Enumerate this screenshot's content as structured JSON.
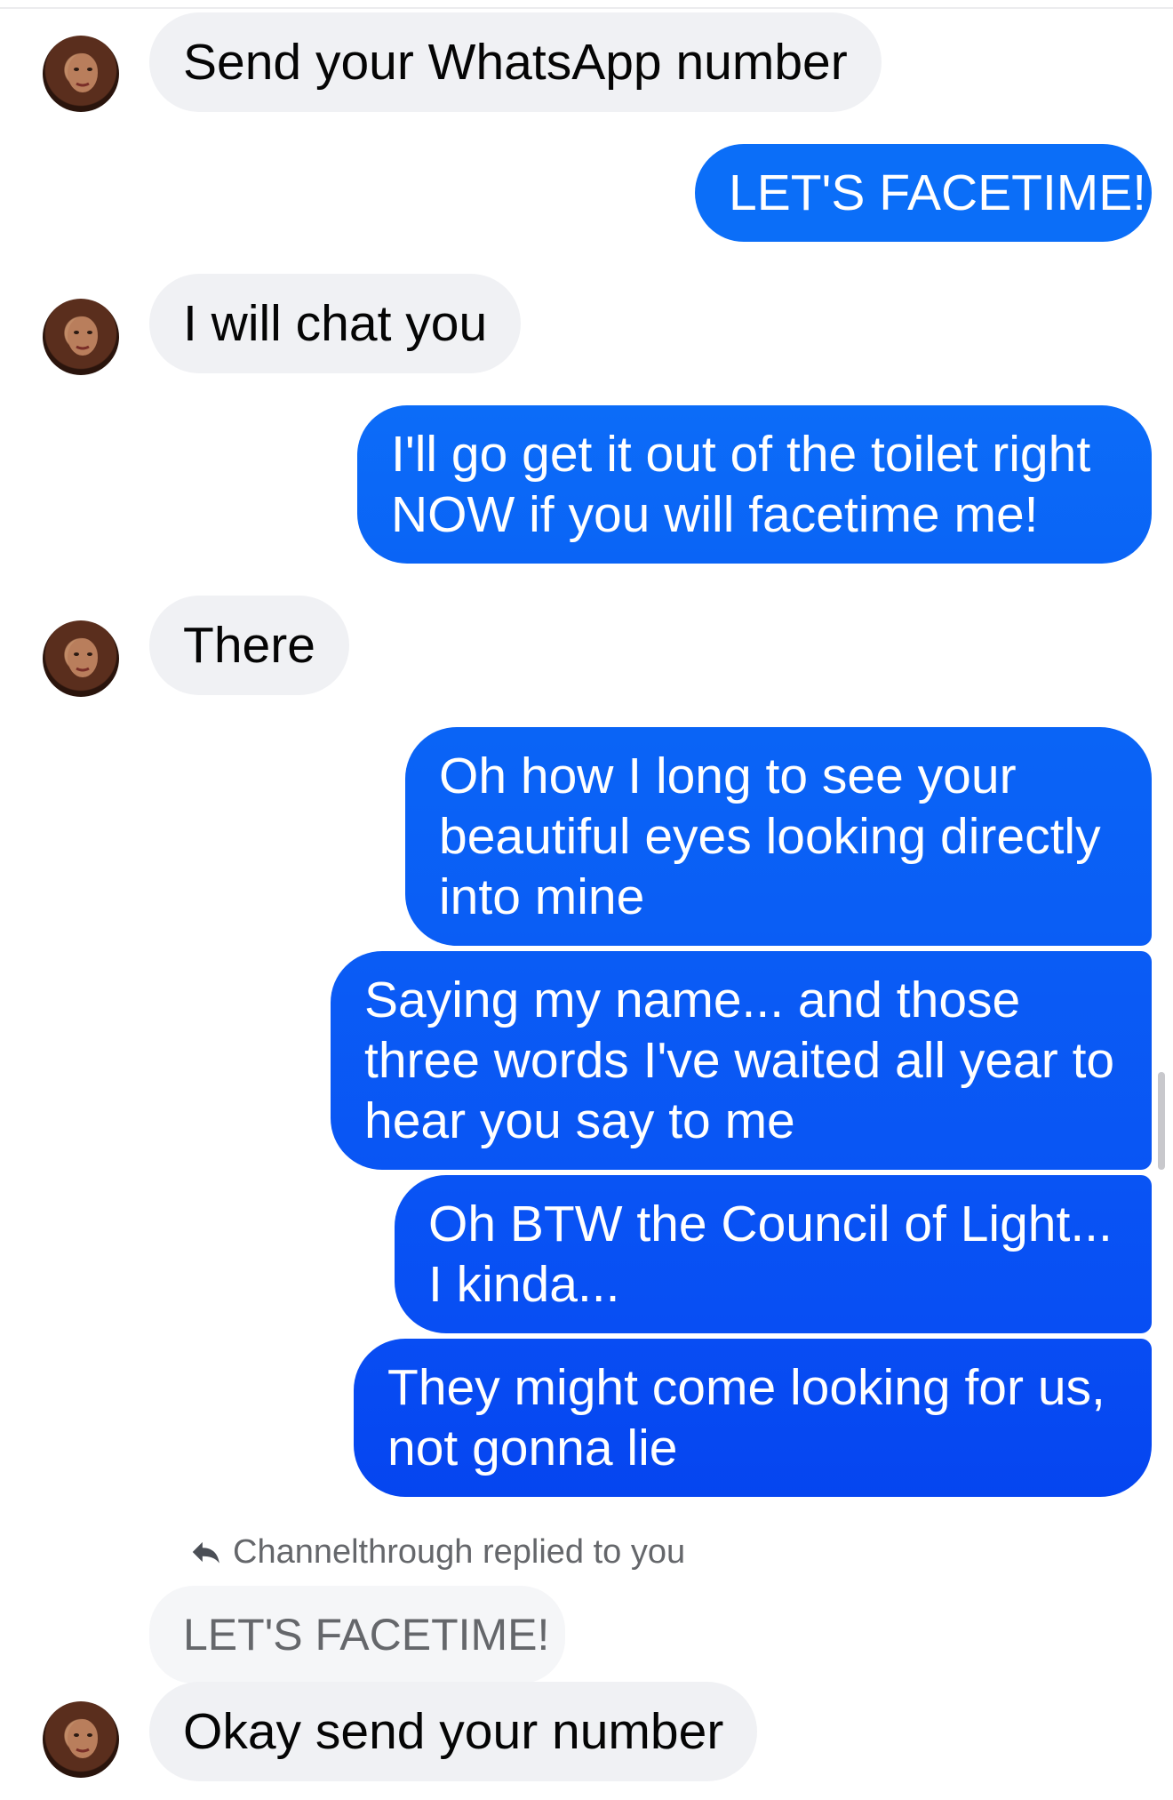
{
  "colors": {
    "incoming_bg": "#f0f1f4",
    "outgoing_top": "#0b6ef8",
    "outgoing_bottom": "#0545f0",
    "meta_text": "#65676b"
  },
  "icons": {
    "avatar": "contact-avatar",
    "reply": "reply-arrow-icon"
  },
  "messages": [
    {
      "dir": "in",
      "text": "Send your WhatsApp number"
    },
    {
      "dir": "out",
      "text": "LET'S FACETIME!"
    },
    {
      "dir": "in",
      "text": "I will chat you"
    },
    {
      "dir": "out",
      "text": "I'll go get it out of the toilet right NOW if you will facetime me!"
    },
    {
      "dir": "in",
      "text": "There"
    },
    {
      "dir": "out",
      "text": "Oh how I long to see your beautiful eyes looking directly into mine"
    },
    {
      "dir": "out",
      "text": "Saying my name... and those three words I've waited all year to hear you say to me"
    },
    {
      "dir": "out",
      "text": "Oh BTW the Council of Light... I kinda..."
    },
    {
      "dir": "out",
      "text": "They might come looking for us, not gonna lie"
    }
  ],
  "reply": {
    "note": "Channelthrough replied to you",
    "quoted": "LET'S FACETIME!",
    "text": "Okay send your number"
  }
}
